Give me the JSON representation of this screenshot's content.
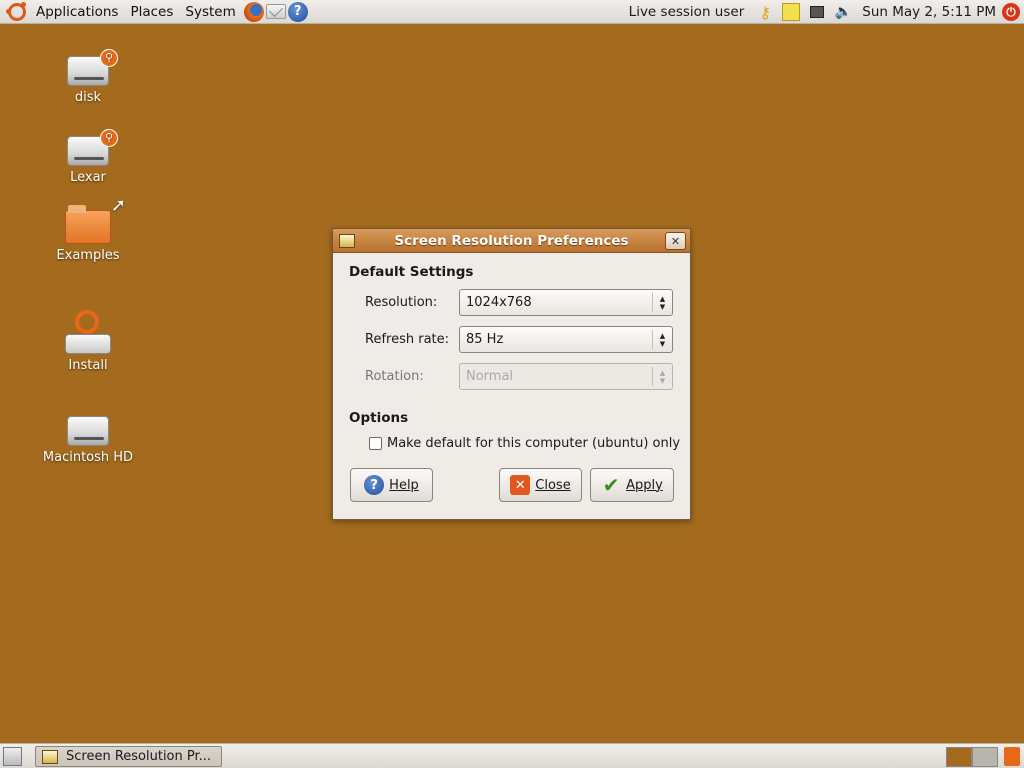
{
  "top_panel": {
    "menus": [
      "Applications",
      "Places",
      "System"
    ],
    "user": "Live session user",
    "clock": "Sun May  2,  5:11 PM"
  },
  "desktop": {
    "icons": [
      {
        "label": "disk",
        "icon": "usb-drive-icon"
      },
      {
        "label": "Lexar",
        "icon": "usb-drive-icon"
      },
      {
        "label": "Examples",
        "icon": "folder-link-icon"
      },
      {
        "label": "Install",
        "icon": "install-icon"
      },
      {
        "label": "Macintosh HD",
        "icon": "hard-drive-icon"
      }
    ]
  },
  "dialog": {
    "title": "Screen Resolution Preferences",
    "default_settings_title": "Default Settings",
    "resolution_label": "Resolution:",
    "resolution_value": "1024x768",
    "refresh_label": "Refresh rate:",
    "refresh_value": "85 Hz",
    "rotation_label": "Rotation:",
    "rotation_value": "Normal",
    "options_title": "Options",
    "make_default_label": "Make default for this computer (ubuntu) only",
    "help_label": "Help",
    "close_label": "Close",
    "apply_label": "Apply"
  },
  "taskbar": {
    "window_button": "Screen Resolution Pr..."
  },
  "colors": {
    "desktop": "#a46b1e",
    "titlebar": "#c98444"
  }
}
